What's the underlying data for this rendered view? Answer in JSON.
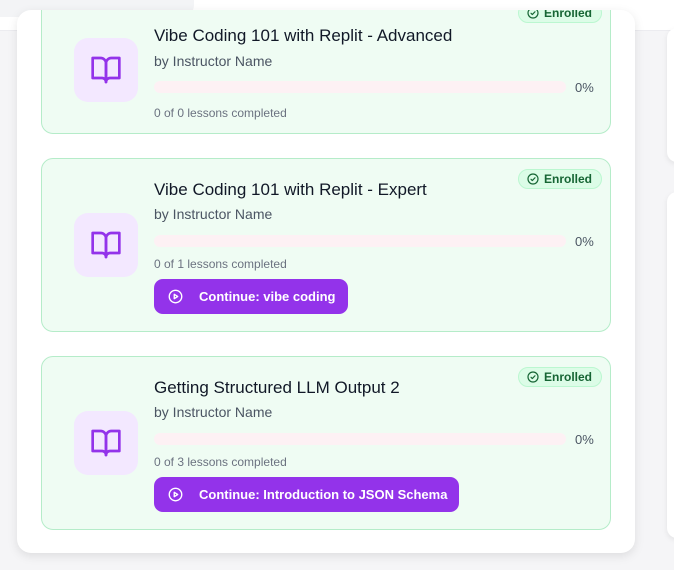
{
  "courses": [
    {
      "title": "Vibe Coding 101 with Replit - Advanced",
      "instructor": "by Instructor Name",
      "progress_percent": 0,
      "progress_label": "0%",
      "lessons_label": "0 of 0 lessons completed",
      "badge": "Enrolled",
      "icon": "book-icon"
    },
    {
      "title": "Vibe Coding 101 with Replit - Expert",
      "instructor": "by Instructor Name",
      "progress_percent": 0,
      "progress_label": "0%",
      "lessons_label": "0 of 1 lessons completed",
      "badge": "Enrolled",
      "continue_label": "Continue: vibe coding",
      "icon": "book-icon"
    },
    {
      "title": "Getting Structured LLM Output 2",
      "instructor": "by Instructor Name",
      "progress_percent": 0,
      "progress_label": "0%",
      "lessons_label": "0 of 3 lessons completed",
      "badge": "Enrolled",
      "continue_label": "Continue: Introduction to JSON Schema",
      "icon": "book-icon"
    }
  ],
  "colors": {
    "card_bg": "#effcf3",
    "card_border": "#b5ecc9",
    "accent": "#9333ea",
    "badge_bg": "#dcfce7",
    "badge_text": "#166534",
    "thumb_bg": "#f3e8ff"
  }
}
